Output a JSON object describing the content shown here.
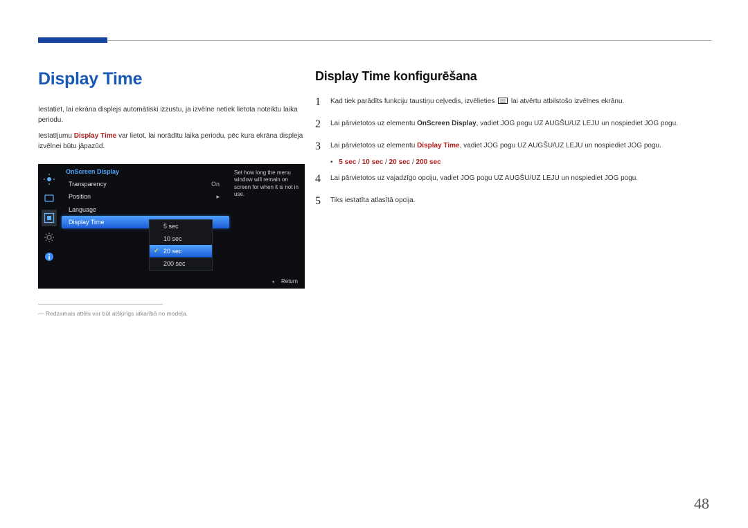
{
  "page_number": "48",
  "title": "Display Time",
  "intro_1_a": "Iestatiet, lai ekrāna displejs automātiski izzustu, ja izvēlne netiek lietota noteiktu laika periodu.",
  "intro_2_pre": "Iestatījumu ",
  "intro_2_kw": "Display Time",
  "intro_2_post": " var lietot, lai norādītu laika periodu, pēc kura ekrāna displeja izvēlnei būtu jāpazūd.",
  "subtitle": "Display Time konfigurēšana",
  "steps": {
    "s1_pre": "Kad tiek parādīts funkciju taustiņu ceļvedis, izvēlieties ",
    "s1_post": " lai atvērtu atbilstošo izvēlnes ekrānu.",
    "s2_pre": "Lai pārvietotos uz elementu ",
    "s2_kw": "OnScreen Display",
    "s2_post": ", vadiet JOG pogu UZ AUGŠU/UZ LEJU un nospiediet JOG pogu.",
    "s3_pre": "Lai pārvietotos uz elementu ",
    "s3_kw": "Display Time",
    "s3_post": ", vadiet JOG pogu UZ AUGŠU/UZ LEJU un nospiediet JOG pogu.",
    "s4": "Lai pārvietotos uz vajadzīgo opciju, vadiet JOG pogu UZ AUGŠU/UZ LEJU un nospiediet JOG pogu.",
    "s5": "Tiks iestatīta atlasītā opcija."
  },
  "options_line": {
    "o1": "5 sec",
    "o2": "10 sec",
    "o3": "20 sec",
    "o4": "200 sec"
  },
  "osd": {
    "header": "OnScreen Display",
    "items": {
      "transparency": "Transparency",
      "transparency_val": "On",
      "position": "Position",
      "language": "Language",
      "display_time": "Display Time"
    },
    "popup": {
      "a": "5 sec",
      "b": "10 sec",
      "c": "20 sec",
      "d": "200 sec"
    },
    "desc": "Set how long the menu window will remain on screen for when it is not in use.",
    "return": "Return"
  },
  "footnote": "―  Redzamais attēls var būt atšķirīgs atkarībā no modeļa."
}
